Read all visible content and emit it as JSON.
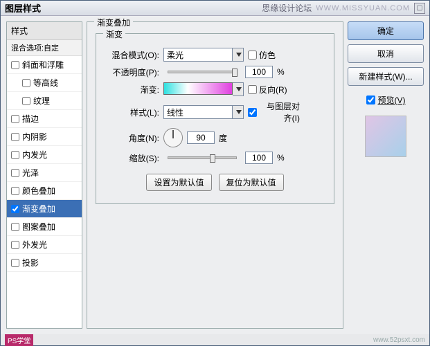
{
  "title": "图层样式",
  "watermark_text": "思缘设计论坛",
  "watermark_url": "WWW.MISSYUAN.COM",
  "sidebar": {
    "header": "样式",
    "sub": "混合选项:自定",
    "items": [
      {
        "label": "斜面和浮雕",
        "checked": false,
        "indent": false
      },
      {
        "label": "等高线",
        "checked": false,
        "indent": true
      },
      {
        "label": "纹理",
        "checked": false,
        "indent": true
      },
      {
        "label": "描边",
        "checked": false,
        "indent": false
      },
      {
        "label": "内阴影",
        "checked": false,
        "indent": false
      },
      {
        "label": "内发光",
        "checked": false,
        "indent": false
      },
      {
        "label": "光泽",
        "checked": false,
        "indent": false
      },
      {
        "label": "颜色叠加",
        "checked": false,
        "indent": false
      },
      {
        "label": "渐变叠加",
        "checked": true,
        "indent": false,
        "selected": true
      },
      {
        "label": "图案叠加",
        "checked": false,
        "indent": false
      },
      {
        "label": "外发光",
        "checked": false,
        "indent": false
      },
      {
        "label": "投影",
        "checked": false,
        "indent": false
      }
    ]
  },
  "panel": {
    "group_title": "渐变叠加",
    "inner_title": "渐变",
    "blend_mode_label": "混合模式(O):",
    "blend_mode_value": "柔光",
    "dither_label": "仿色",
    "opacity_label": "不透明度(P):",
    "opacity_value": "100",
    "pct": "%",
    "gradient_label": "渐变:",
    "reverse_label": "反向(R)",
    "style_label": "样式(L):",
    "style_value": "线性",
    "align_label": "与图层对齐(I)",
    "angle_label": "角度(N):",
    "angle_value": "90",
    "degree": "度",
    "scale_label": "缩放(S):",
    "scale_value": "100",
    "set_default": "设置为默认值",
    "reset_default": "复位为默认值"
  },
  "buttons": {
    "ok": "确定",
    "cancel": "取消",
    "new_style": "新建样式(W)...",
    "preview": "预览(V)"
  },
  "footer": {
    "tag": "PS学堂",
    "url": "www.52psxt.com"
  }
}
